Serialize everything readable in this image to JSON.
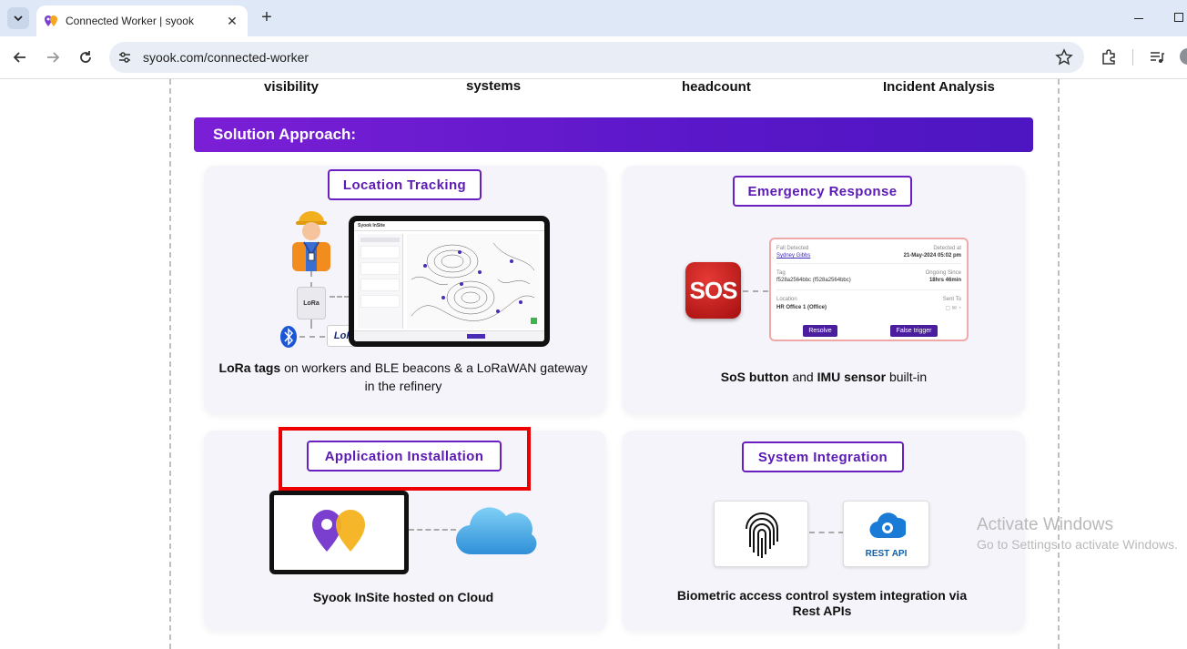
{
  "browser": {
    "tab_title": "Connected Worker | syook",
    "url": "syook.com/connected-worker"
  },
  "top_labels": [
    "visibility",
    "systems",
    "headcount",
    "Incident Analysis"
  ],
  "banner": {
    "title": "Solution Approach:"
  },
  "cards": {
    "location": {
      "pill": "Location Tracking",
      "caption_bold": "LoRa tags",
      "caption_rest": " on workers and BLE beacons & a LoRaWAN gateway in the refinery",
      "lora_chip": "LoRa",
      "lorawan": "LoRaWAN",
      "tablet_brand": "Syook InSite"
    },
    "emergency": {
      "pill": "Emergency Response",
      "sos_label": "SOS",
      "caption_b1": "SoS button",
      "caption_mid": " and ",
      "caption_b2": "IMU sensor",
      "caption_end": " built-in",
      "panel": {
        "fall_label": "Fall Detected",
        "detected_label": "Detected at",
        "name": "Sydney Gibbs",
        "detected_at": "21-May-2024 05:02 pm",
        "tag_label": "Tag",
        "ongoing_label": "Ongoing Since",
        "tag": "f528a2564bbc (f528a2564bbc)",
        "ongoing": "18hrs 46min",
        "location_label": "Location",
        "sent_label": "Sent To",
        "location": "HR Office 1 (Office)",
        "resolve": "Resolve",
        "false_trigger": "False trigger"
      }
    },
    "application": {
      "pill": "Application Installation",
      "caption_pre": "Syook InSite hosted on ",
      "caption_bold": "Cloud"
    },
    "integration": {
      "pill": "System Integration",
      "caption_line1": "Biometric access control system integration via",
      "caption_line2": "Rest APIs",
      "rest_api": "REST API"
    }
  },
  "watermark": {
    "line1": "Activate Windows",
    "line2": "Go to Settings to activate Windows."
  },
  "colors": {
    "brand_purple": "#5b1ab4",
    "banner_start": "#7b1fd6",
    "banner_end": "#4d16c2",
    "highlight_red": "#ee0000",
    "logo_purple": "#7b3fcf",
    "logo_orange": "#f5a623"
  }
}
